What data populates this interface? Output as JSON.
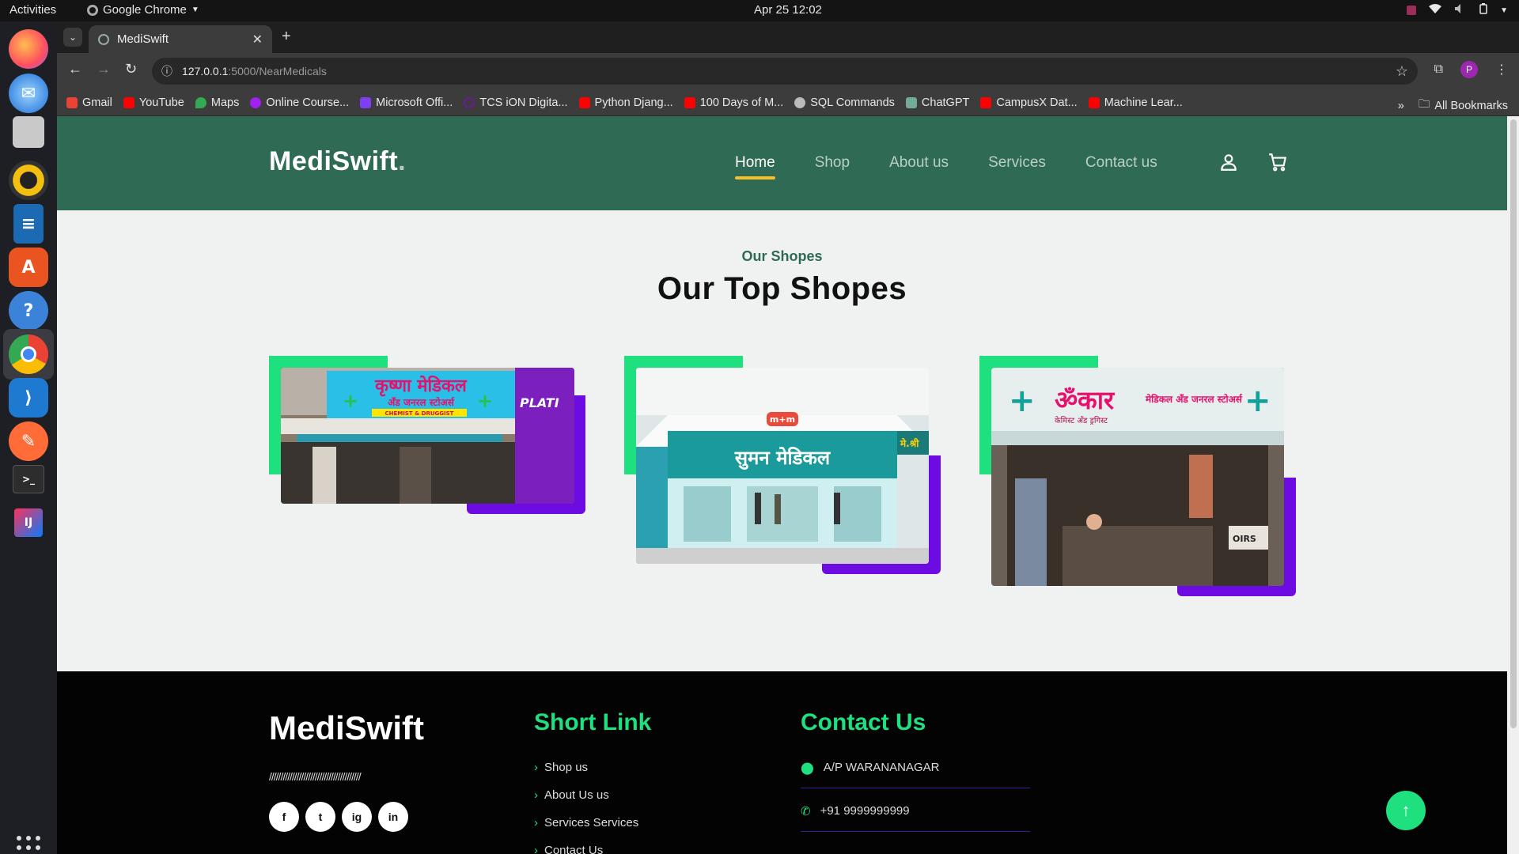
{
  "os": {
    "activities": "Activities",
    "app_name": "Google Chrome",
    "clock": "Apr 25  12:02"
  },
  "browser": {
    "tab_title": "MediSwift",
    "url_host": "127.0.0.1",
    "url_path": ":5000/NearMedicals",
    "profile_initial": "P",
    "bookmarks": [
      {
        "label": "Gmail",
        "color": "#ea4335"
      },
      {
        "label": "YouTube",
        "color": "#ff0000"
      },
      {
        "label": "Maps",
        "color": "#34a853"
      },
      {
        "label": "Online Course...",
        "color": "#a020f0"
      },
      {
        "label": "Microsoft Offi...",
        "color": "#7e3ff2"
      },
      {
        "label": "TCS iON Digita...",
        "color": "#6a1b9a"
      },
      {
        "label": "Python Djang...",
        "color": "#ff0000"
      },
      {
        "label": "100 Days of M...",
        "color": "#ff0000"
      },
      {
        "label": "SQL Commands",
        "color": "#999999"
      },
      {
        "label": "ChatGPT",
        "color": "#74aa9c"
      },
      {
        "label": "CampusX Dat...",
        "color": "#ff0000"
      },
      {
        "label": "Machine Lear...",
        "color": "#ff0000"
      }
    ],
    "all_bookmarks": "All Bookmarks"
  },
  "site": {
    "brand": "MediSwift",
    "brand_dot": ".",
    "nav": [
      "Home",
      "Shop",
      "About us",
      "Services",
      "Contact us"
    ],
    "active_nav": "Home",
    "colors": {
      "header": "#2f6a55",
      "accent_green": "#1ee07f",
      "accent_purple": "#6c0be2",
      "nav_underline": "#f9bf29"
    },
    "section_sub": "Our Shopes",
    "section_title": "Our Top Shopes",
    "shops": [
      {
        "sign": "कृष्णा मेडिकल",
        "sub": "अँड जनरल स्टोअर्स",
        "tag": "CHEMIST & DRUGGIST",
        "side": "PLATI"
      },
      {
        "sign": "सुमन मेडिकल",
        "badge": "m+m",
        "side": "मे.श्री"
      },
      {
        "sign": "ॐकार",
        "sub": "मेडिकल अँड जनरल स्टोअर्स",
        "small": "केमिस्ट अँड ड्रगिस्ट",
        "side": "OIRS"
      }
    ]
  },
  "footer": {
    "brand": "MediSwift",
    "slashes": "////////////////////////////////////////",
    "social": [
      "f",
      "t",
      "ig",
      "in"
    ],
    "short_link_title": "Short Link",
    "short_links": [
      "Shop us",
      "About Us us",
      "Services Services",
      "Contact Us"
    ],
    "contact_title": "Contact Us",
    "address": "A/P WARANANAGAR",
    "phone": "+91 9999999999"
  }
}
